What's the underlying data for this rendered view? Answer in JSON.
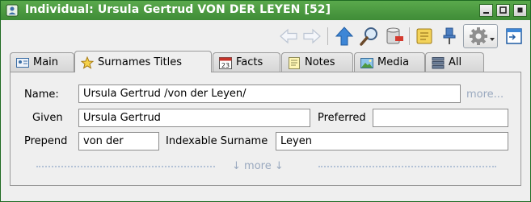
{
  "window": {
    "title": "Individual: Ursula Gertrud VON DER LEYEN [52]"
  },
  "theme": {
    "titlebar_color": "#4a9b40",
    "panel_bg": "#efefef",
    "link_color": "#9aa9bf"
  },
  "title_buttons": [
    {
      "name": "minimize",
      "icon": "minimize-icon"
    },
    {
      "name": "maximize",
      "icon": "maximize-icon"
    },
    {
      "name": "close",
      "icon": "close-icon"
    }
  ],
  "toolbar": {
    "icons": [
      "back-arrow-icon",
      "forward-arrow-icon",
      "up-arrow-icon",
      "search-icon",
      "database-record-icon",
      "scroll-icon",
      "pin-icon",
      "settings-gear-icon",
      "window-icon"
    ]
  },
  "tabs": [
    {
      "label": "Main",
      "icon": "id-card-icon"
    },
    {
      "label": "Surnames  Titles",
      "icon": "star-icon",
      "active": true
    },
    {
      "label": "Facts",
      "icon": "calendar-icon"
    },
    {
      "label": "Notes",
      "icon": "note-icon"
    },
    {
      "label": "Media",
      "icon": "picture-icon"
    },
    {
      "label": "All",
      "icon": "list-icon"
    }
  ],
  "calendar_icon_text": "23",
  "form": {
    "name_label": "Name:",
    "name_value": "Ursula Gertrud /von der Leyen/",
    "more_link": "more...",
    "given_label": "Given",
    "given_value": "Ursula Gertrud",
    "preferred_label": "Preferred",
    "preferred_value": "",
    "prepend_label": "Prepend",
    "prepend_value": "von der",
    "indexable_label": "Indexable Surname",
    "indexable_value": "Leyen",
    "more_bar": "↓  more  ↓"
  }
}
